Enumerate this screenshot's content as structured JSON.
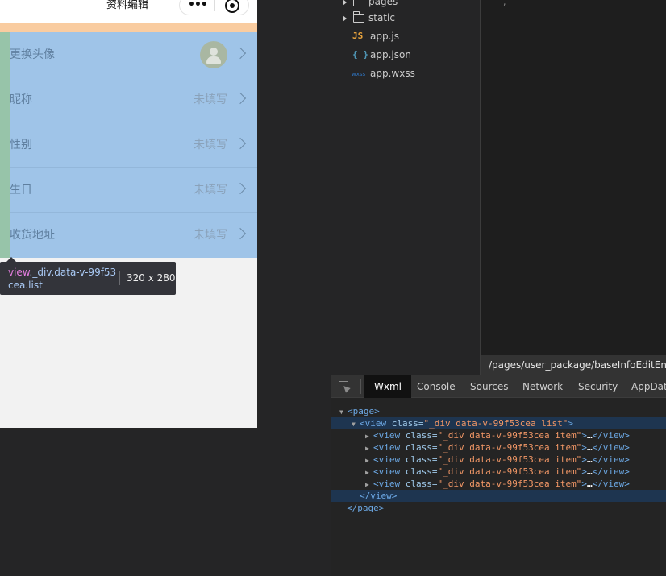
{
  "simulator": {
    "title": "资料编辑",
    "capsule_menu_icon": "more-dots-icon",
    "capsule_close_icon": "record-icon",
    "items": [
      {
        "label": "更换头像",
        "value": ""
      },
      {
        "label": "昵称",
        "value": "未填写"
      },
      {
        "label": "性别",
        "value": "未填写"
      },
      {
        "label": "生日",
        "value": "未填写"
      },
      {
        "label": "收货地址",
        "value": "未填写"
      }
    ],
    "tooltip": {
      "tag": "view",
      "selector": "._div.data-v-99f53cea.list",
      "size": "320 x 280"
    }
  },
  "filetree": {
    "items": [
      {
        "name": "pages",
        "kind": "folder"
      },
      {
        "name": "static",
        "kind": "folder"
      },
      {
        "name": "app.js",
        "kind": "js",
        "icon": "JS"
      },
      {
        "name": "app.json",
        "kind": "json",
        "icon": "{ }"
      },
      {
        "name": "app.wxss",
        "kind": "wxss",
        "icon": "wxss"
      }
    ]
  },
  "editor": {
    "path": "/pages/user_package/baseInfoEditEntry/m"
  },
  "devtools": {
    "tabs": [
      "Wxml",
      "Console",
      "Sources",
      "Network",
      "Security",
      "AppData"
    ],
    "active_tab": "Wxml",
    "dom": {
      "page_open": "<page>",
      "list_tag": "<view",
      "list_attr": "class=",
      "list_val": "\"_div data-v-99f53cea list\"",
      "item_tag": "<view",
      "item_attr": "class=",
      "item_val": "\"_div data-v-99f53cea item\"",
      "item_close": "</view>",
      "ellipsis": "…",
      "view_close": "</view>",
      "page_close": "</page>"
    }
  },
  "colors": {
    "content_highlight": "#9fc4e8",
    "padding_highlight": "#f9cca0",
    "margin_highlight": "#97c4a9",
    "tooltip_bg": "#33343a"
  }
}
